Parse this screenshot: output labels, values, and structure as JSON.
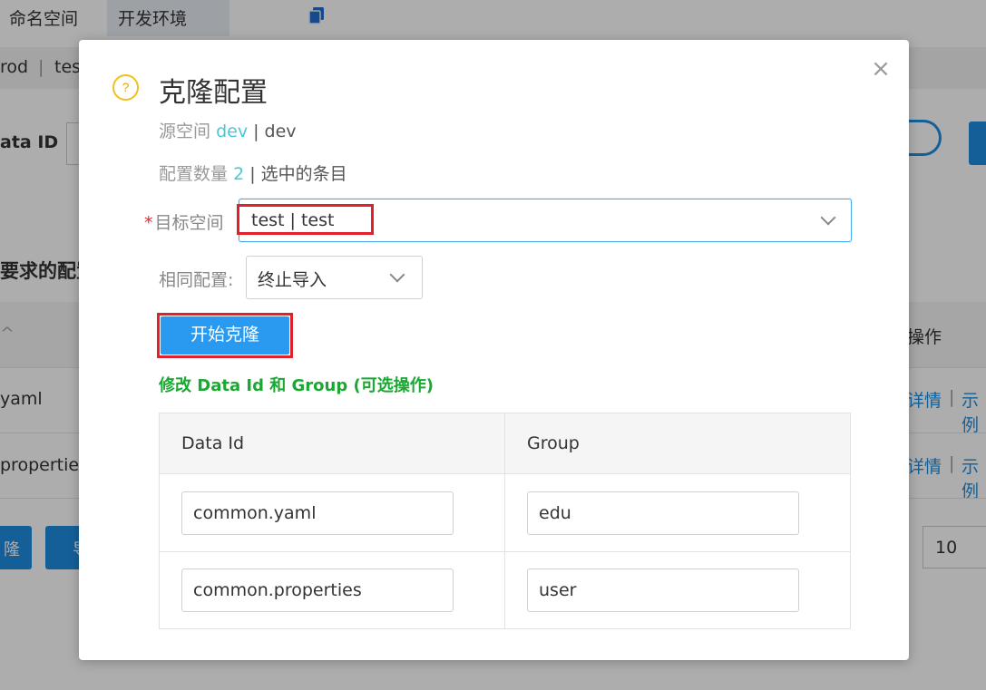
{
  "background": {
    "namespaces": [
      "命名空间",
      "开发环境"
    ],
    "breadcrumb": [
      "rod",
      "|",
      "tes"
    ],
    "data_id_label": "ata ID",
    "config_label": "要求的配置",
    "table_header_left": "^",
    "table_header_right": "操作",
    "rows": [
      {
        "name": "yaml",
        "actions": [
          "详情",
          "|",
          "示例"
        ]
      },
      {
        "name": "properties",
        "actions": [
          "详情",
          "|",
          "示例"
        ]
      }
    ],
    "page_size": "10",
    "bottom_buttons": [
      "隆",
      "导"
    ]
  },
  "dialog": {
    "title": "克隆配置",
    "source_label": "源空间",
    "source_ns": "dev",
    "source_suffix": "| dev",
    "count_label": "配置数量",
    "count_value": "2",
    "count_suffix": "| 选中的条目",
    "target_label": "目标空间",
    "target_value": "test | test",
    "same_label": "相同配置:",
    "same_value": "终止导入",
    "start_button": "开始克隆",
    "edit_title": "修改 Data Id 和 Group (可选操作)",
    "table": {
      "headers": [
        "Data Id",
        "Group"
      ],
      "rows": [
        {
          "data_id": "common.yaml",
          "group": "edu"
        },
        {
          "data_id": "common.properties",
          "group": "user"
        }
      ]
    },
    "close": "×",
    "help": "?"
  },
  "colors": {
    "accent": "#2a9af0",
    "highlight": "#4cc7d8",
    "success": "#1aa832",
    "annotation": "#e0202a"
  }
}
